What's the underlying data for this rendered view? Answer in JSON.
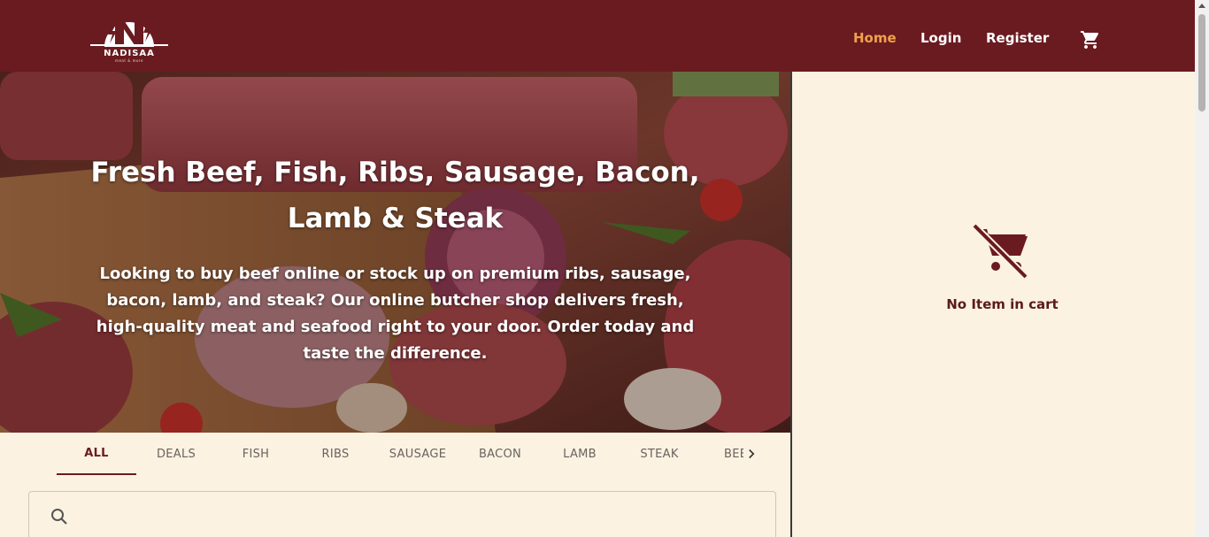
{
  "header": {
    "logo_text": "NADISAA",
    "logo_tagline": "meat & more",
    "nav": {
      "home": "Home",
      "login": "Login",
      "register": "Register"
    },
    "cart_icon": "shopping-cart-icon"
  },
  "hero": {
    "title": "Fresh Beef, Fish, Ribs, Sausage, Bacon, Lamb & Steak",
    "description": "Looking to buy beef online or stock up on premium ribs, sausage, bacon, lamb, and steak? Our online butcher shop delivers fresh, high-quality meat and seafood right to your door. Order today and taste the difference."
  },
  "tabs": {
    "items": [
      "ALL",
      "DEALS",
      "FISH",
      "RIBS",
      "SAUSAGE",
      "BACON",
      "LAMB",
      "STEAK",
      "BEEF"
    ],
    "active": "ALL",
    "scroll_icon": "chevron-right-icon"
  },
  "search": {
    "placeholder": "",
    "value": "",
    "icon": "search-icon"
  },
  "cart_panel": {
    "empty_text": "No Item in cart",
    "empty_icon": "remove-shopping-cart-icon"
  },
  "colors": {
    "brand": "#6a1b20",
    "accent": "#f0a24d",
    "background": "#fbf2e1"
  }
}
